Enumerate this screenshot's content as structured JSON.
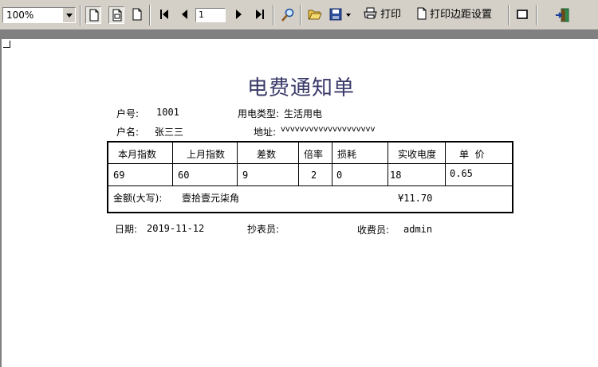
{
  "toolbar": {
    "zoom_value": "100%",
    "page_number": "1",
    "print_label": "打印",
    "print_margin_label": "打印边距设置"
  },
  "report": {
    "title": "电费通知单",
    "account_label": "户号:",
    "account_value": "1001",
    "usage_type_label": "用电类型:",
    "usage_type_value": "生活用电",
    "name_label": "户名:",
    "name_value": "张三三",
    "address_label": "地址:",
    "address_value": "vvvvvvvvvvvvvvvvvvvv",
    "table": {
      "headers": [
        "本月指数",
        "上月指数",
        "差数",
        "倍率",
        "损耗",
        "实收电度",
        "单  价"
      ],
      "row": [
        "69",
        "60",
        "9",
        "2",
        "0",
        "18",
        "0.65"
      ]
    },
    "amount_label": "金额(大写):",
    "amount_words": "壹拾壹元柒角",
    "amount_value": "¥11.70",
    "date_label": "日期:",
    "date_value": "2019-11-12",
    "meter_reader_label": "抄表员:",
    "meter_reader_value": "",
    "collector_label": "收费员:",
    "collector_value": "admin"
  }
}
